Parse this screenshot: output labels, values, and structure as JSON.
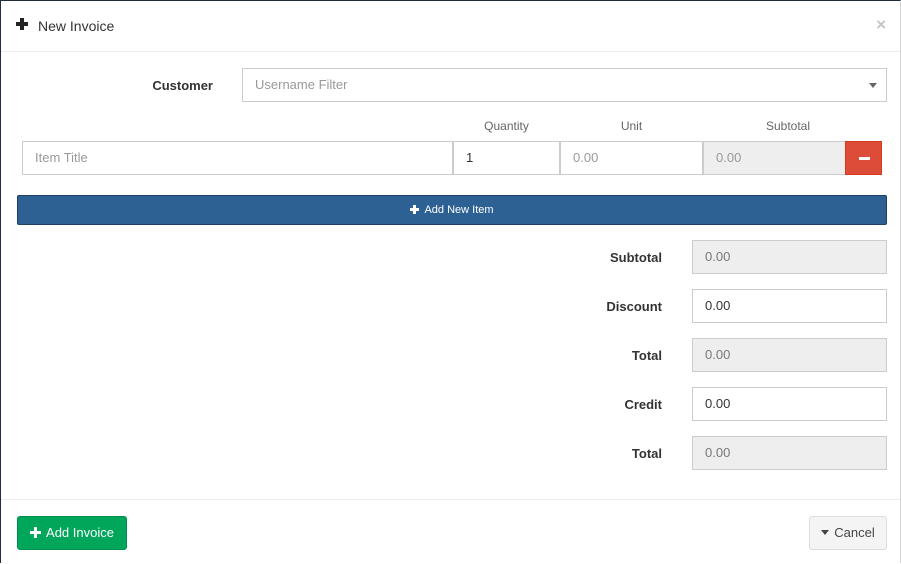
{
  "header": {
    "title": "New Invoice",
    "close_label": "×"
  },
  "customer": {
    "label": "Customer",
    "placeholder": "Username Filter"
  },
  "items": {
    "columns": {
      "quantity": "Quantity",
      "unit": "Unit",
      "subtotal": "Subtotal"
    },
    "rows": [
      {
        "title_placeholder": "Item Title",
        "quantity": "1",
        "unit_placeholder": "0.00",
        "subtotal": "0.00"
      }
    ],
    "add_label": "Add New Item"
  },
  "totals": {
    "subtotal_label": "Subtotal",
    "subtotal_value": "0.00",
    "discount_label": "Discount",
    "discount_value": "0.00",
    "total_label": "Total",
    "total_value": "0.00",
    "credit_label": "Credit",
    "credit_value": "0.00",
    "grand_total_label": "Total",
    "grand_total_value": "0.00"
  },
  "footer": {
    "add_invoice_label": "Add Invoice",
    "cancel_label": "Cancel"
  },
  "colors": {
    "primary": "#2e6193",
    "success": "#00a65a",
    "danger": "#dd4b39"
  }
}
